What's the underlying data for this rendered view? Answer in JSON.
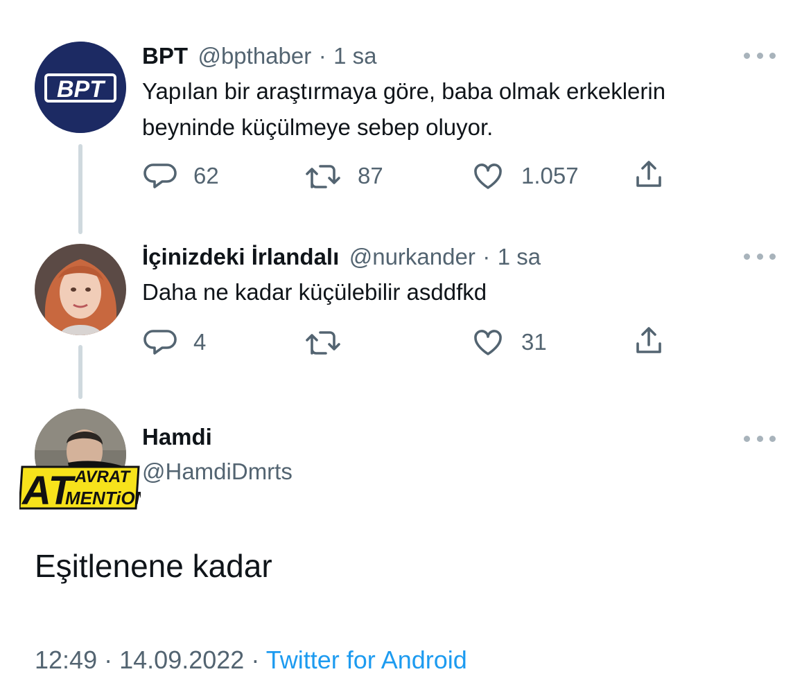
{
  "tweets": [
    {
      "display_name": "BPT",
      "handle": "@bpthaber",
      "dot": "·",
      "time": "1 sa",
      "text_line1": "Yapılan bir araştırmaya göre, baba olmak erkeklerin",
      "text_line2": "beyninde küçülmeye sebep oluyor.",
      "replies": "62",
      "retweets": "87",
      "likes": "1.057",
      "avatar_logo_text": "BPT"
    },
    {
      "display_name": "İçinizdeki İrlandalı",
      "handle": "@nurkander",
      "dot": "·",
      "time": "1 sa",
      "text": "Daha ne kadar küçülebilir asddfkd",
      "replies": "4",
      "retweets": "",
      "likes": "31"
    }
  ],
  "main_tweet": {
    "display_name": "Hamdi",
    "handle": "@HamdiDmrts",
    "text": "Eşitlenene kadar",
    "time": "12:49",
    "sep1": "·",
    "date": "14.09.2022",
    "sep2": "·",
    "source": "Twitter for Android"
  },
  "watermark": {
    "big": "AT",
    "top": "AVRAT",
    "bottom": "MENTiON"
  },
  "colors": {
    "text": "#0f1419",
    "secondary": "#536471",
    "link": "#1d9bf0",
    "thread_line": "#cfd9de",
    "bpt_avatar_bg": "#1c2a63",
    "watermark_yellow": "#f7e21b"
  },
  "icons": [
    "reply-icon",
    "retweet-icon",
    "like-icon",
    "share-icon",
    "more-icon"
  ]
}
